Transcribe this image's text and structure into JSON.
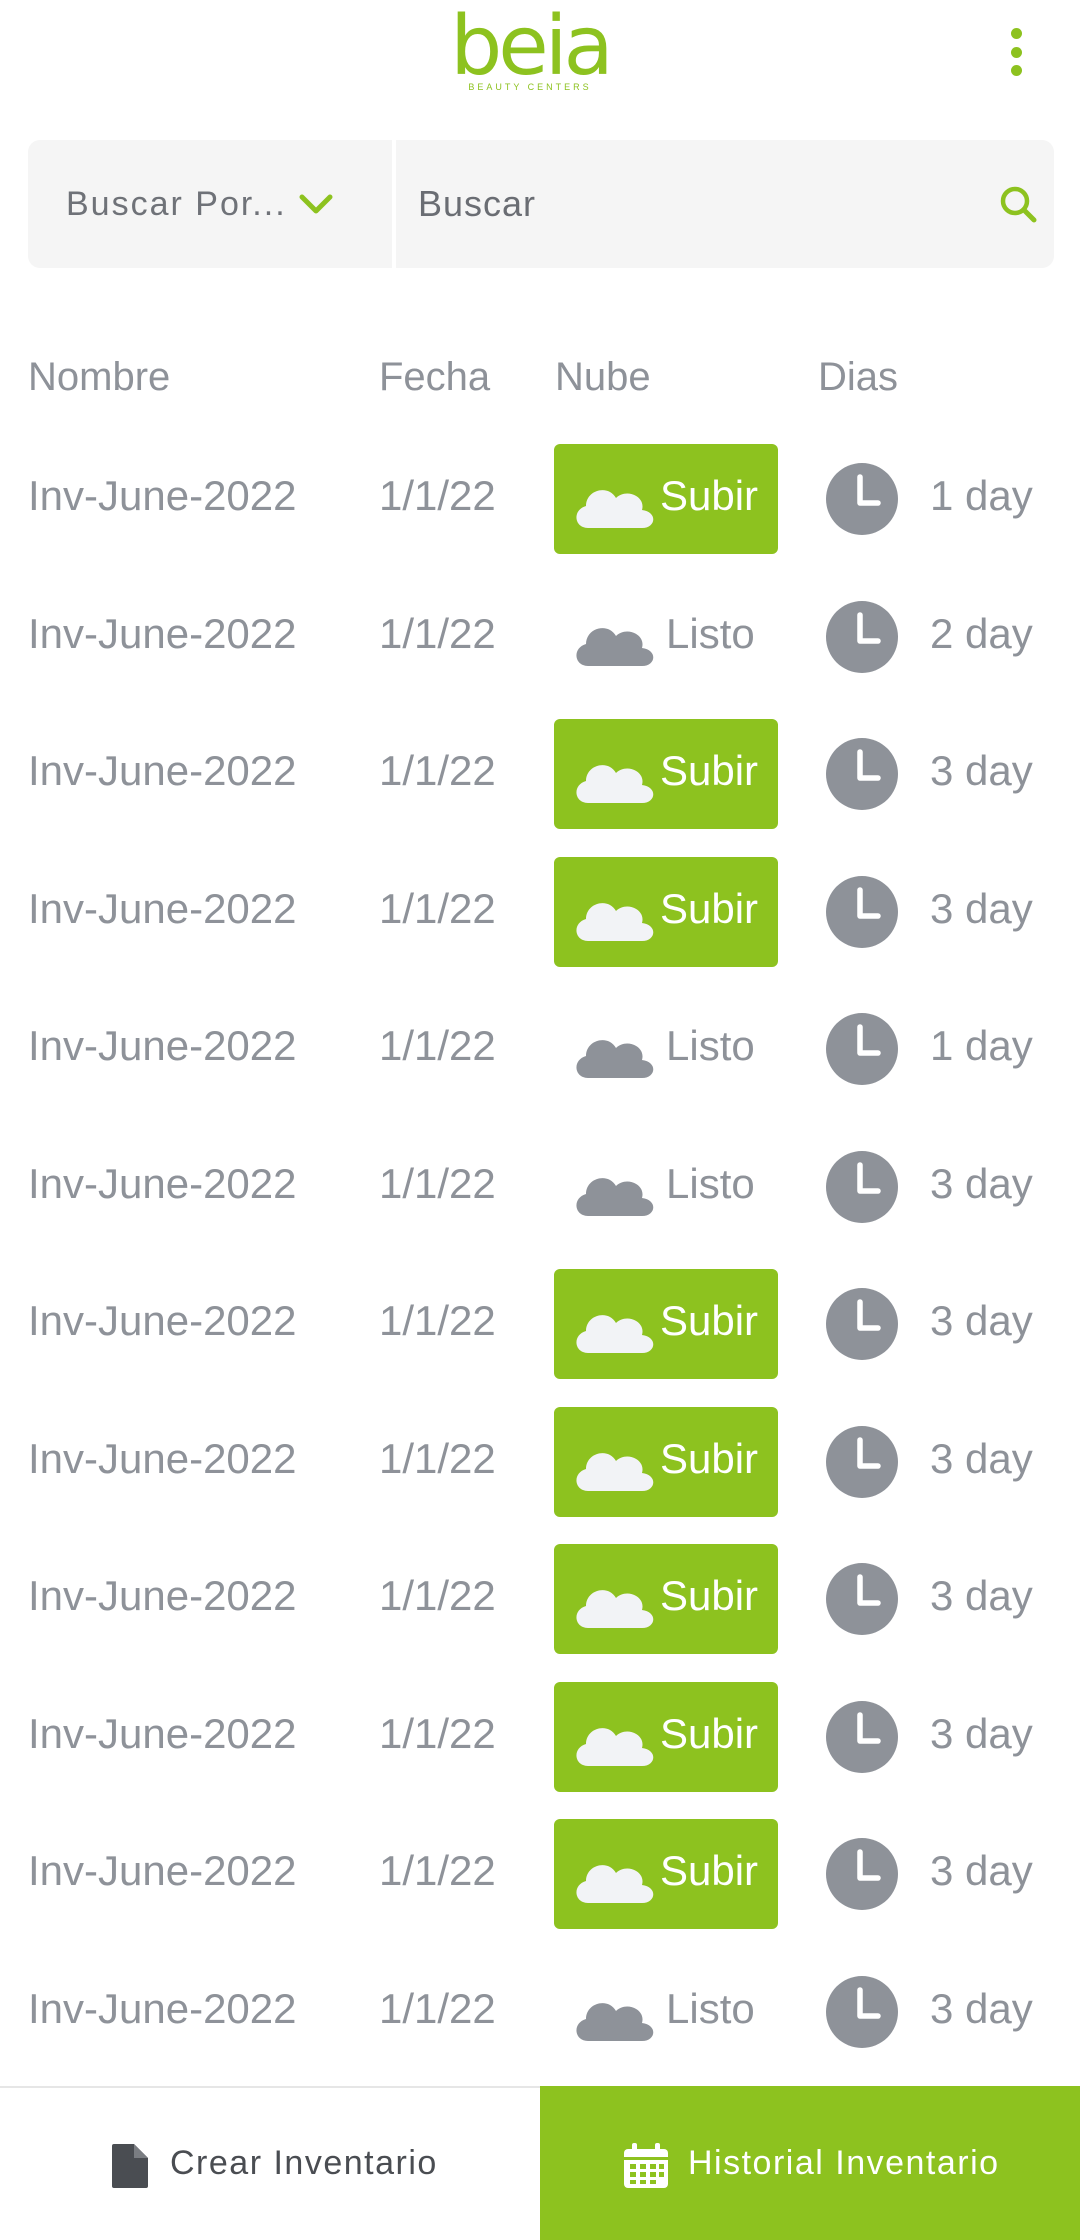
{
  "header": {
    "logo_text": "beia",
    "logo_tagline": "BEAUTY CENTERS",
    "menu_icon": "more-vertical-icon"
  },
  "search": {
    "filter_label": "Buscar Por...",
    "placeholder": "Buscar",
    "value": ""
  },
  "table": {
    "headers": {
      "name": "Nombre",
      "date": "Fecha",
      "cloud": "Nube",
      "days": "Dias"
    },
    "rows": [
      {
        "name": "Inv-June-2022",
        "date": "1/1/22",
        "status": "subir",
        "cloud_label": "Subir",
        "days": "1 day"
      },
      {
        "name": "Inv-June-2022",
        "date": "1/1/22",
        "status": "listo",
        "cloud_label": "Listo",
        "days": "2 day"
      },
      {
        "name": "Inv-June-2022",
        "date": "1/1/22",
        "status": "subir",
        "cloud_label": "Subir",
        "days": "3 day"
      },
      {
        "name": "Inv-June-2022",
        "date": "1/1/22",
        "status": "subir",
        "cloud_label": "Subir",
        "days": "3 day"
      },
      {
        "name": "Inv-June-2022",
        "date": "1/1/22",
        "status": "listo",
        "cloud_label": "Listo",
        "days": "1 day"
      },
      {
        "name": "Inv-June-2022",
        "date": "1/1/22",
        "status": "listo",
        "cloud_label": "Listo",
        "days": "3 day"
      },
      {
        "name": "Inv-June-2022",
        "date": "1/1/22",
        "status": "subir",
        "cloud_label": "Subir",
        "days": "3 day"
      },
      {
        "name": "Inv-June-2022",
        "date": "1/1/22",
        "status": "subir",
        "cloud_label": "Subir",
        "days": "3 day"
      },
      {
        "name": "Inv-June-2022",
        "date": "1/1/22",
        "status": "subir",
        "cloud_label": "Subir",
        "days": "3 day"
      },
      {
        "name": "Inv-June-2022",
        "date": "1/1/22",
        "status": "subir",
        "cloud_label": "Subir",
        "days": "3 day"
      },
      {
        "name": "Inv-June-2022",
        "date": "1/1/22",
        "status": "subir",
        "cloud_label": "Subir",
        "days": "3 day"
      },
      {
        "name": "Inv-June-2022",
        "date": "1/1/22",
        "status": "listo",
        "cloud_label": "Listo",
        "days": "3 day"
      }
    ]
  },
  "bottom_nav": {
    "create_label": "Crear Inventario",
    "create_icon": "document-icon",
    "history_label": "Historial Inventario",
    "history_icon": "calendar-icon",
    "active": "history"
  },
  "colors": {
    "brand_green": "#8dc21f",
    "text_gray": "#8e9299",
    "cloud_white": "#f2f3f6",
    "field_bg": "#f5f5f5"
  }
}
